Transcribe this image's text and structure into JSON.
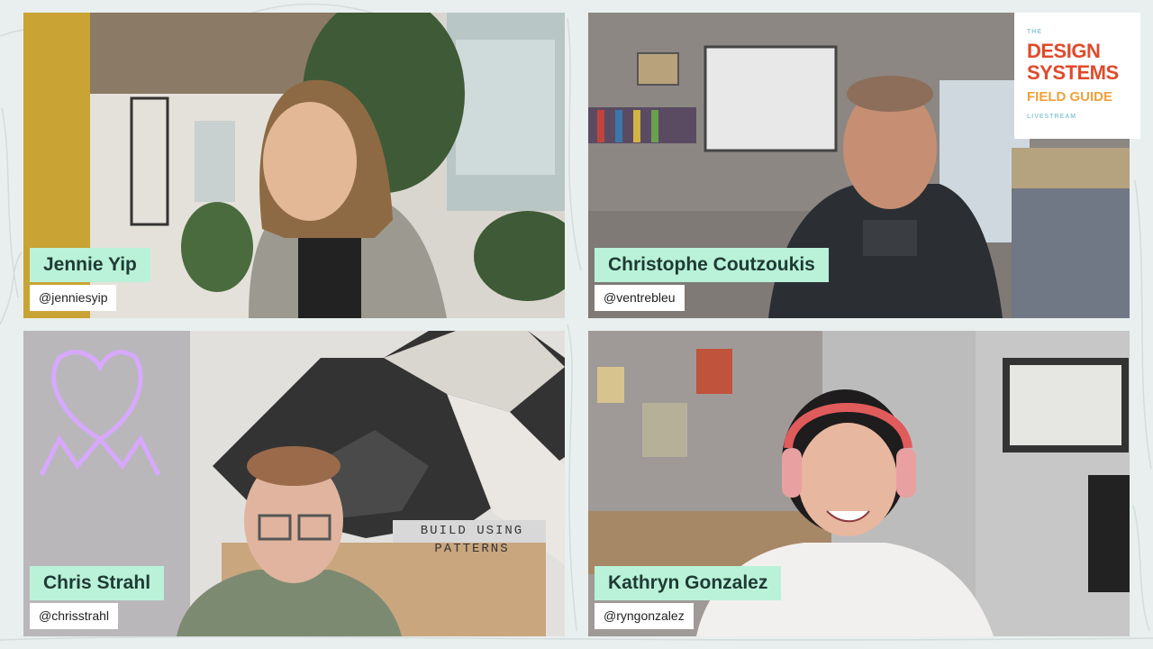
{
  "participants": [
    {
      "name": "Jennie Yip",
      "handle": "@jenniesyip"
    },
    {
      "name": "Christophe Coutzoukis",
      "handle": "@ventrebleu"
    },
    {
      "name": "Chris Strahl",
      "handle": "@chrisstrahl"
    },
    {
      "name": "Kathryn Gonzalez",
      "handle": "@ryngonzalez"
    }
  ],
  "logo": {
    "the": "THE",
    "line1": "DESIGN",
    "line2": "SYSTEMS",
    "line3": "FIELD GUIDE",
    "line4": "LIVESTREAM"
  },
  "sign_text": {
    "line1": "BUILD USING",
    "line2": "PATTERNS"
  },
  "colors": {
    "nameplate": "#b9f2d9",
    "logo_red": "#e04a2b",
    "logo_orange": "#f0a13a",
    "logo_blue": "#8fc9d6"
  }
}
